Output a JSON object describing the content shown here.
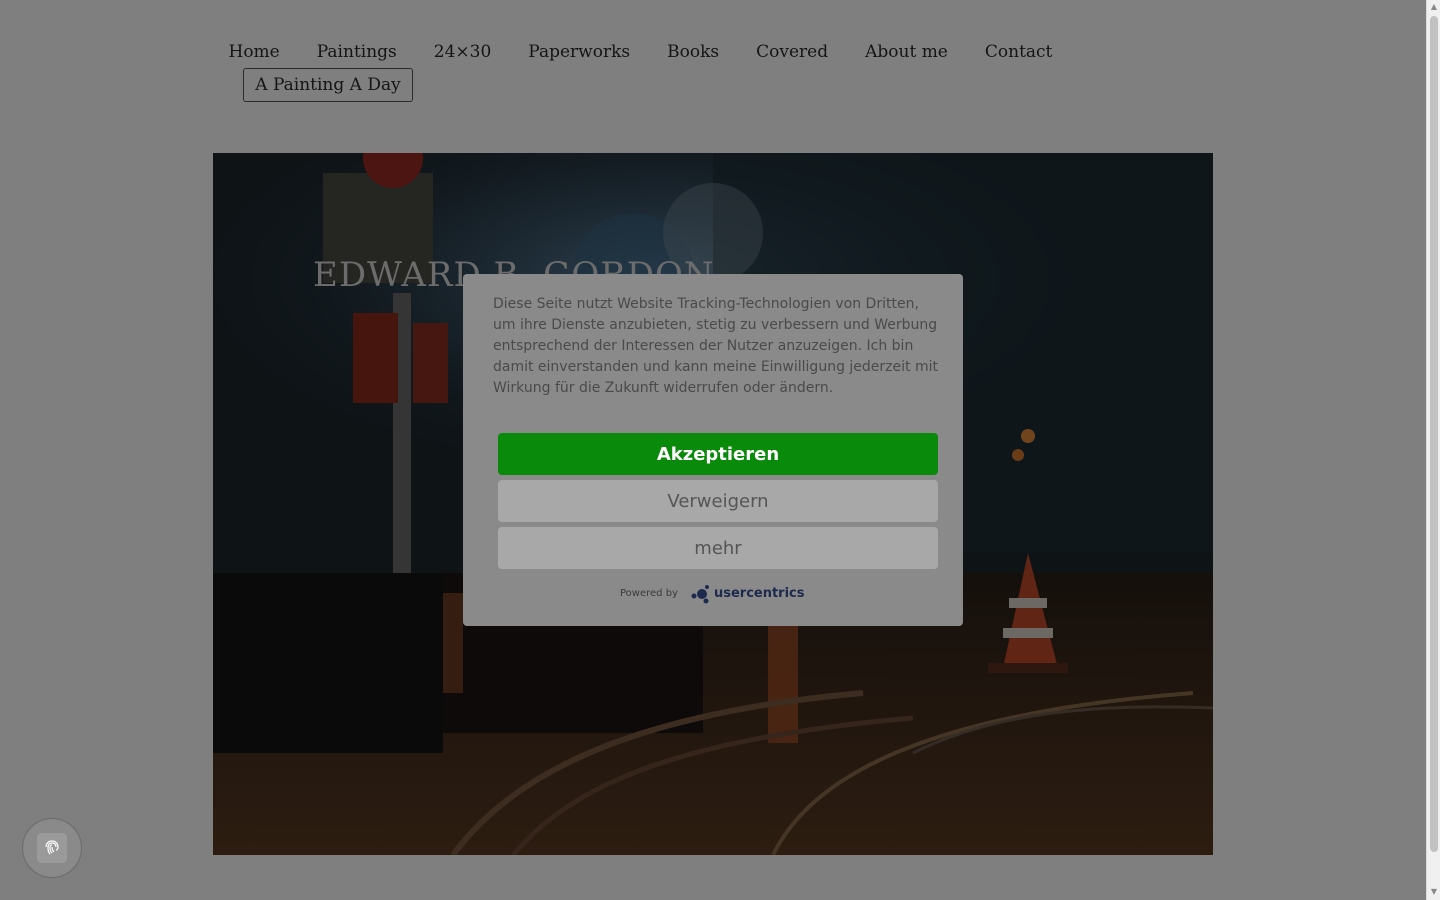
{
  "nav": {
    "items": [
      {
        "label": "Home",
        "active": true
      },
      {
        "label": "Paintings"
      },
      {
        "label": "24×30"
      },
      {
        "label": "Paperworks"
      },
      {
        "label": "Books"
      },
      {
        "label": "Covered"
      },
      {
        "label": "About me"
      },
      {
        "label": "Contact"
      }
    ],
    "sub_item": "A Painting A Day"
  },
  "hero": {
    "title": "EDWARD B. GORDON"
  },
  "consent": {
    "text": "Diese Seite nutzt Website Tracking-Technologien von Dritten, um ihre Dienste anzubieten, stetig zu verbessern und Werbung entsprechend der Interessen der Nutzer anzuzeigen. Ich bin damit einverstanden und kann meine Einwilligung jederzeit mit Wirkung für die Zukunft widerrufen oder ändern.",
    "accept_label": "Akzeptieren",
    "deny_label": "Verweigern",
    "more_label": "mehr",
    "powered_by": "Powered by",
    "brand": "usercentrics"
  },
  "colors": {
    "accept": "#0a8a0a",
    "dialog_bg": "#8a8a8a"
  },
  "icons": {
    "privacy": "fingerprint-icon"
  }
}
